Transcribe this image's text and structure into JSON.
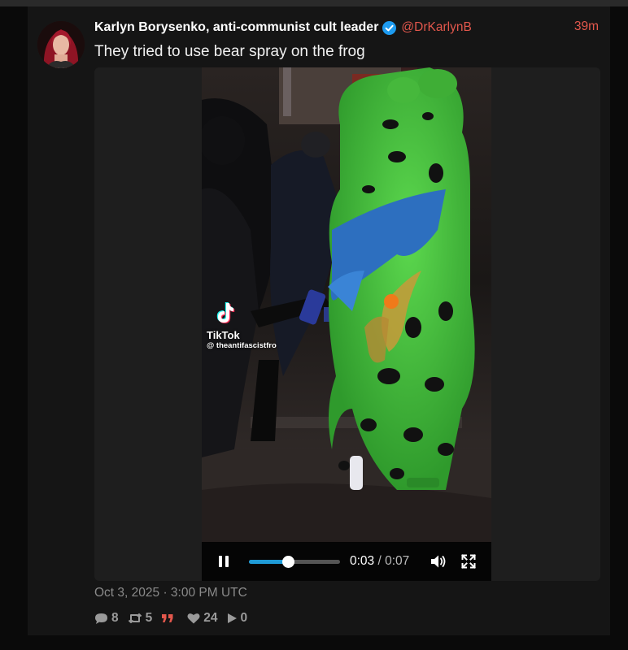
{
  "post": {
    "author_name": "Karlyn Borysenko, anti-communist cult leader",
    "handle": "@DrKarlynB",
    "relative_time": "39m",
    "text": "They tried to use bear spray on the frog",
    "date": "Oct 3, 2025 · 3:00 PM UTC"
  },
  "video": {
    "watermark_brand": "TikTok",
    "watermark_user": "@ theantifascistfro",
    "current_time": "0:03",
    "separator": "/",
    "total_time": "0:07",
    "progress": 0.43,
    "state": "playing"
  },
  "stats": {
    "replies": "8",
    "reposts": "5",
    "likes": "24",
    "plays": "0"
  },
  "icons": {
    "verified": "verified-badge-icon",
    "replies": "comment-icon",
    "reposts": "repost-icon",
    "quote": "quote-icon",
    "likes": "heart-icon",
    "plays": "play-icon"
  },
  "colors": {
    "accent": "#e2574c",
    "verified": "#1d9bf0",
    "seek": "#1f9bd7",
    "background": "#151515"
  }
}
